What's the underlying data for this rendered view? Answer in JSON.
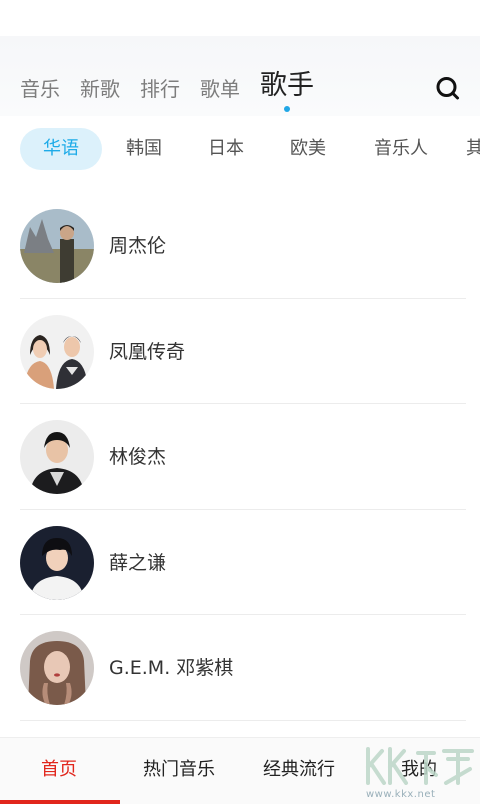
{
  "top_tabs": [
    {
      "label": "音乐"
    },
    {
      "label": "新歌"
    },
    {
      "label": "排行"
    },
    {
      "label": "歌单"
    },
    {
      "label": "歌手",
      "active": true
    }
  ],
  "search": {
    "icon": "search-icon"
  },
  "categories": [
    {
      "label": "华语",
      "active": true
    },
    {
      "label": "韩国"
    },
    {
      "label": "日本"
    },
    {
      "label": "欧美"
    },
    {
      "label": "音乐人"
    },
    {
      "label": "其"
    }
  ],
  "artists": [
    {
      "name": "周杰伦"
    },
    {
      "name": "凤凰传奇"
    },
    {
      "name": "林俊杰"
    },
    {
      "name": "薛之谦"
    },
    {
      "name": "G.E.M. 邓紫棋"
    }
  ],
  "bottom_nav": [
    {
      "label": "首页",
      "active": true
    },
    {
      "label": "热门音乐"
    },
    {
      "label": "经典流行"
    },
    {
      "label": "我的"
    }
  ],
  "watermark": {
    "logo_text": "KK下载",
    "url": "www.kkx.net"
  },
  "colors": {
    "accent_blue": "#1eabe8",
    "accent_red": "#e1261c",
    "chip_bg": "#dcf1fb"
  }
}
